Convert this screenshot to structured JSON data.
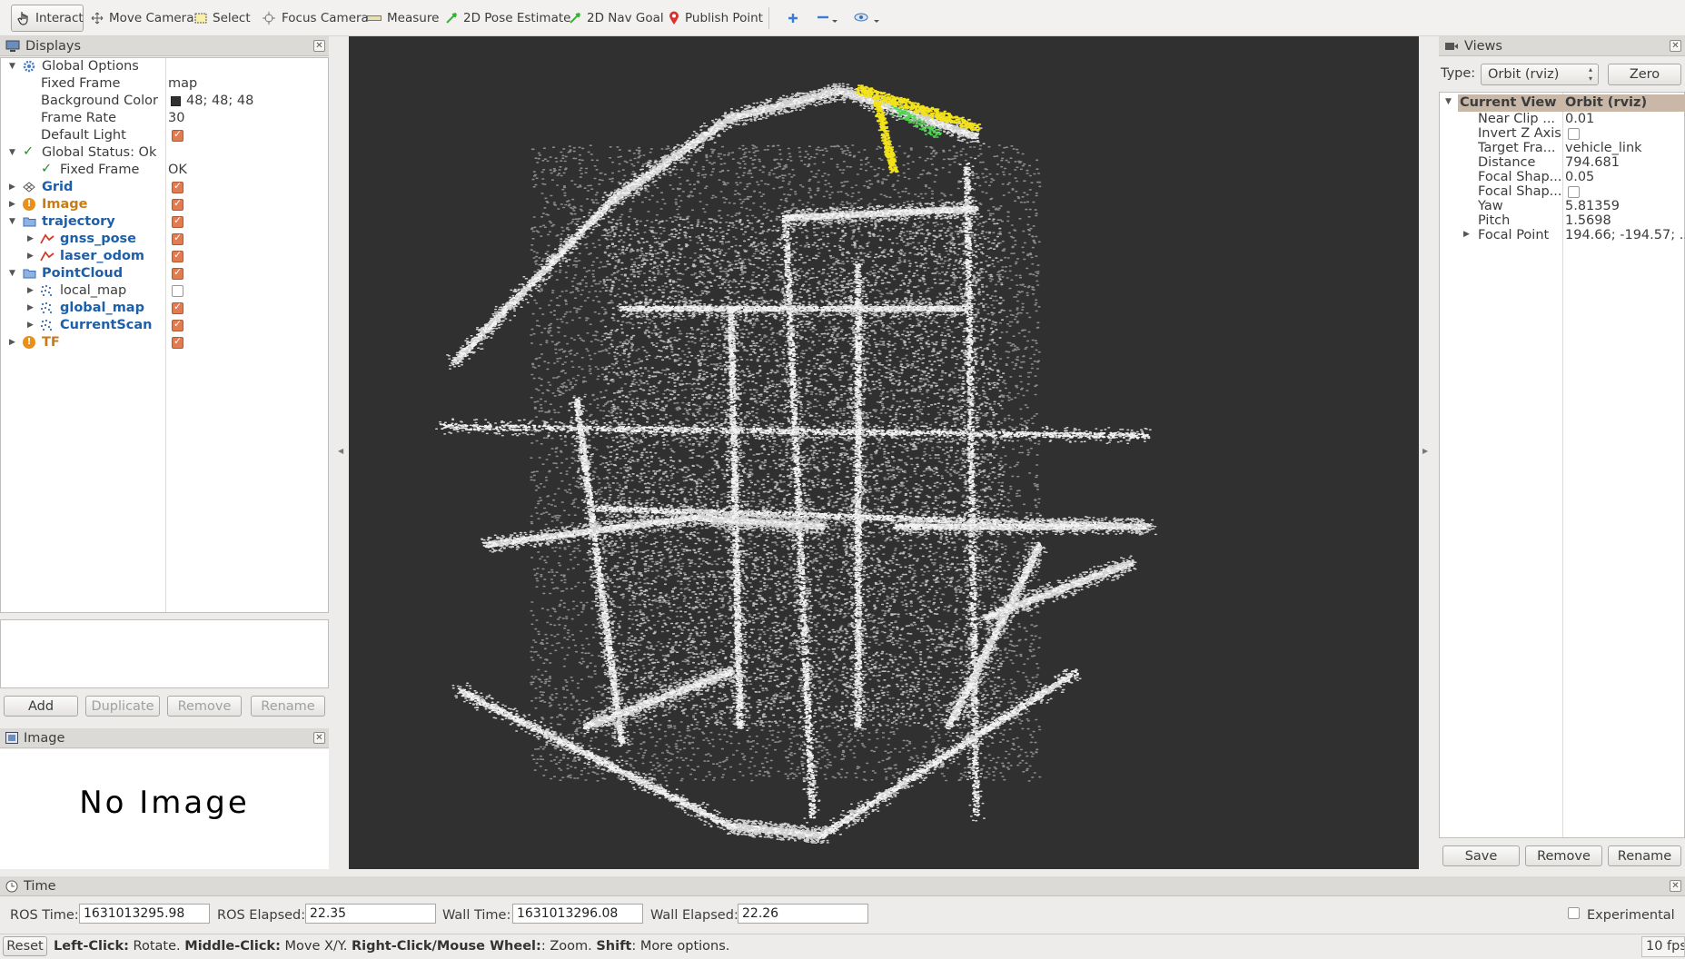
{
  "toolbar": {
    "interact": "Interact",
    "move_camera": "Move Camera",
    "select": "Select",
    "focus_camera": "Focus Camera",
    "measure": "Measure",
    "pose_estimate": "2D Pose Estimate",
    "nav_goal": "2D Nav Goal",
    "publish_point": "Publish Point"
  },
  "displays": {
    "title": "Displays",
    "rows": {
      "global_options": "Global Options",
      "fixed_frame": "Fixed Frame",
      "fixed_frame_val": "map",
      "background_color": "Background Color",
      "background_color_val": "48; 48; 48",
      "frame_rate": "Frame Rate",
      "frame_rate_val": "30",
      "default_light": "Default Light",
      "global_status": "Global Status: Ok",
      "fixed_frame_status": "Fixed Frame",
      "fixed_frame_status_val": "OK",
      "grid": "Grid",
      "image": "Image",
      "trajectory": "trajectory",
      "gnss_pose": "gnss_pose",
      "laser_odom": "laser_odom",
      "pointcloud": "PointCloud",
      "local_map": "local_map",
      "global_map": "global_map",
      "current_scan": "CurrentScan",
      "tf": "TF"
    },
    "buttons": {
      "add": "Add",
      "duplicate": "Duplicate",
      "remove": "Remove",
      "rename": "Rename"
    }
  },
  "image_panel": {
    "title": "Image",
    "placeholder": "No Image"
  },
  "views": {
    "title": "Views",
    "type_label": "Type:",
    "type_value": "Orbit (rviz)",
    "zero": "Zero",
    "current_view": "Current View",
    "current_view_val": "Orbit (rviz)",
    "props": [
      {
        "name": "Near Clip ...",
        "value": "0.01"
      },
      {
        "name": "Invert Z Axis",
        "value": ""
      },
      {
        "name": "Target Fra...",
        "value": "vehicle_link"
      },
      {
        "name": "Distance",
        "value": "794.681"
      },
      {
        "name": "Focal Shap...",
        "value": "0.05"
      },
      {
        "name": "Focal Shap...",
        "value": ""
      },
      {
        "name": "Yaw",
        "value": "5.81359"
      },
      {
        "name": "Pitch",
        "value": "1.5698"
      },
      {
        "name": "Focal Point",
        "value": "194.66; -194.57; ..."
      }
    ],
    "buttons": {
      "save": "Save",
      "remove": "Remove",
      "rename": "Rename"
    }
  },
  "time": {
    "title": "Time",
    "ros_time_label": "ROS Time:",
    "ros_time": "1631013295.98",
    "ros_elapsed_label": "ROS Elapsed:",
    "ros_elapsed": "22.35",
    "wall_time_label": "Wall Time:",
    "wall_time": "1631013296.08",
    "wall_elapsed_label": "Wall Elapsed:",
    "wall_elapsed": "22.26",
    "experimental": "Experimental"
  },
  "status": {
    "reset": "Reset",
    "left_click": "Left-Click:",
    "left_click_desc": " Rotate. ",
    "middle_click": "Middle-Click:",
    "middle_click_desc": " Move X/Y. ",
    "right_click": "Right-Click/Mouse Wheel:",
    "right_click_desc": ": Zoom. ",
    "shift": "Shift",
    "shift_desc": ": More options.",
    "fps": "10 fps"
  },
  "colors": {
    "background": "#303030",
    "checkbox_on": "#e27b4f",
    "display_blue": "#1d5fa8",
    "warning_orange": "#c77b17",
    "scan_yellow": "#f2e21a"
  }
}
